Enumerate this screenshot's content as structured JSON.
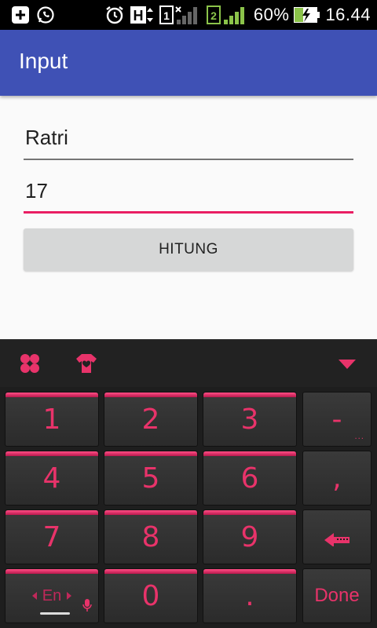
{
  "status_bar": {
    "battery_percent": "60%",
    "time": "16.44",
    "sim1": "1",
    "sim2": "2",
    "network_type": "H",
    "icons": [
      "add-icon",
      "whatsapp-icon",
      "alarm-icon",
      "network-h-icon",
      "sim1-signal-icon",
      "sim2-signal-icon",
      "battery-charging-icon"
    ]
  },
  "app_bar": {
    "title": "Input"
  },
  "form": {
    "name_value": "Ratri",
    "age_value": "17",
    "button_label": "HITUNG"
  },
  "keyboard": {
    "toolbar_icons": [
      "clover-icon",
      "theme-shirt-icon",
      "collapse-keyboard-icon"
    ],
    "rows": [
      [
        "1",
        "2",
        "3",
        "-"
      ],
      [
        "4",
        "5",
        "6",
        ","
      ],
      [
        "7",
        "8",
        "9",
        "enter-arrow-icon"
      ],
      [
        "En",
        "0",
        ".",
        "Done"
      ]
    ],
    "lang_label": "En",
    "done_label": "Done",
    "accent_color": "#e8336a"
  }
}
